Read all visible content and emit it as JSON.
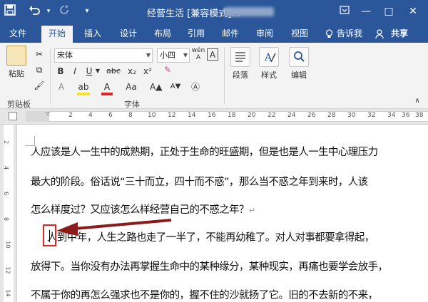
{
  "titlebar": {
    "save_icon": "save-icon",
    "undo_icon": "undo-icon",
    "redo_icon": "redo-icon",
    "title": "经营生活 [兼容模式]...",
    "restore_icon": "ribbon-display-icon",
    "minimize": "—",
    "maximize": "□",
    "close": "✕"
  },
  "menu": {
    "items": [
      "文件",
      "开始",
      "插入",
      "设计",
      "布局",
      "引用",
      "邮件",
      "审阅",
      "视图"
    ],
    "active": "开始",
    "tell_me": "告诉我",
    "share": "共享"
  },
  "ribbon": {
    "clipboard": {
      "paste_label": "粘贴",
      "group_label": "剪贴板"
    },
    "font": {
      "font_name": "宋体",
      "font_size": "小四",
      "pinyin_label": "wén A",
      "bold": "B",
      "italic": "I",
      "underline": "U",
      "strike": "abc",
      "subscript": "x₂",
      "superscript": "x²",
      "text_effect": "A",
      "highlight": "ab",
      "font_color": "A",
      "change_case": "Aa",
      "group_label": "字体"
    },
    "paragraph": {
      "label": "段落"
    },
    "styles": {
      "label": "样式"
    },
    "editing": {
      "label": "编辑"
    }
  },
  "ruler": {
    "ticks": [
      "2",
      "4",
      "6",
      "8",
      "10",
      "12",
      "14",
      "16",
      "18",
      "20",
      "22",
      "24",
      "26",
      "28",
      "30",
      "32",
      "34",
      "36",
      "38"
    ]
  },
  "vruler": {
    "ticks": [
      "2",
      "4",
      "6",
      "8",
      "10",
      "12",
      "14"
    ]
  },
  "document": {
    "lines": [
      "人应该是人一生中的成熟期，正处于生命的旺盛期，但是也是人一生中心理压力",
      "最大的阶段。俗话说“三十而立，四十而不惑”，那么当不惑之年到来时，人该",
      "怎么样度过？又应该怎么样经营自己的不惑之年？",
      "人到中年，人生之路也走了一半了，不能再幼稚了。对人对事都要拿得起，",
      "放得下。当你没有办法再掌握生命中的某种缘分，某种现实，再痛也要学会放手，",
      "不属于你的再怎么强求也不是你的，握不住的沙就扬了它。旧的不去新的不来，"
    ],
    "para_mark": "↵"
  },
  "colors": {
    "ribbon_blue": "#2b579a",
    "arrow": "#8b1a1a",
    "highlight_box": "#e02424"
  }
}
